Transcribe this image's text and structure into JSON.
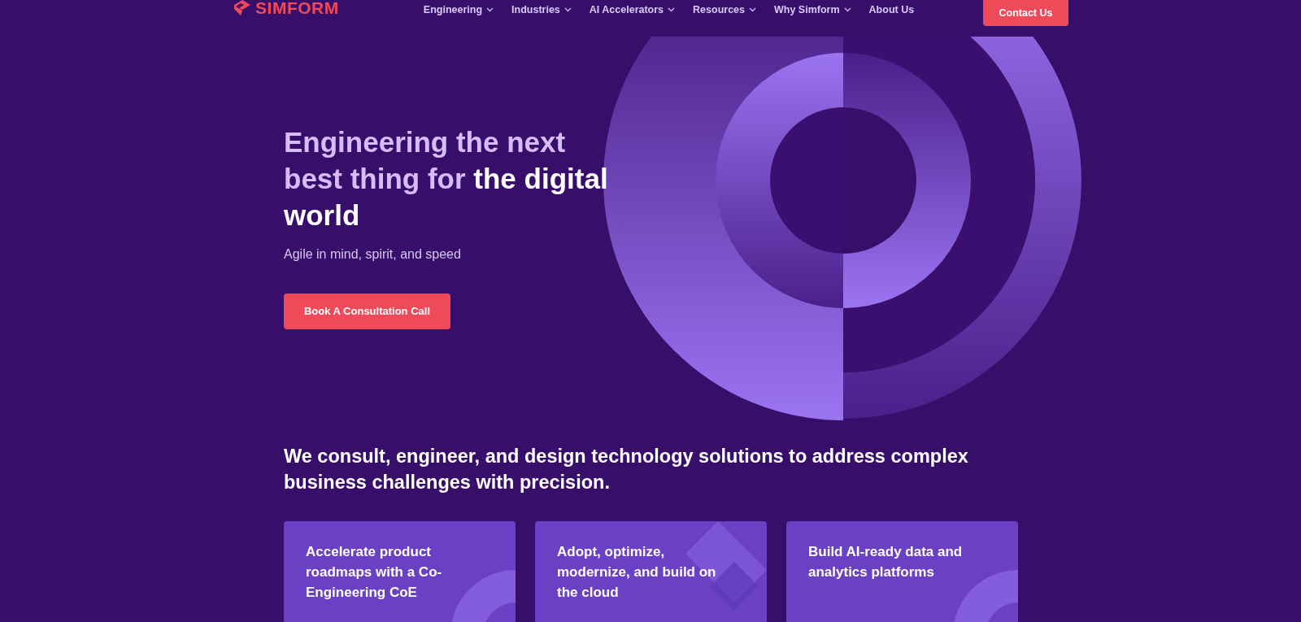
{
  "header": {
    "logo": "SIMFORM",
    "nav": [
      {
        "label": "Engineering",
        "has_menu": true
      },
      {
        "label": "Industries",
        "has_menu": true
      },
      {
        "label": "AI Accelerators",
        "has_menu": true
      },
      {
        "label": "Resources",
        "has_menu": true
      },
      {
        "label": "Why Simform",
        "has_menu": true
      },
      {
        "label": "About Us",
        "has_menu": false
      }
    ],
    "cta": "Contact Us"
  },
  "hero": {
    "headline_lead": "Engineering the next best thing for",
    "headline_tail": "the digital world",
    "subtitle": "Agile in mind, spirit, and speed",
    "button": "Book A Consultation Call"
  },
  "statement": "We consult, engineer, and design technology solutions to address complex business challenges with precision.",
  "cards": [
    {
      "title": "Accelerate product roadmaps with a Co-Engineering CoE",
      "kind": "ring"
    },
    {
      "title": "Adopt, optimize, modernize, and build on the cloud",
      "kind": "diamond"
    },
    {
      "title": "Build AI-ready data and analytics platforms",
      "kind": "ring"
    }
  ]
}
